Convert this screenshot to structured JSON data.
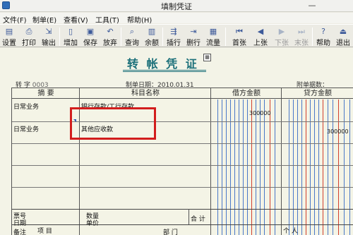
{
  "window": {
    "title": "填制凭证",
    "minimize_glyph": "—"
  },
  "menu": {
    "items": [
      "文件(F)",
      "制单(E)",
      "查看(V)",
      "工具(T)",
      "帮助(H)"
    ]
  },
  "toolbar": {
    "buttons": [
      {
        "label": "设置",
        "icon": "printer-setup-icon",
        "glyph": "▤",
        "enabled": true
      },
      {
        "label": "打印",
        "icon": "printer-icon",
        "glyph": "⎙",
        "enabled": true
      },
      {
        "label": "输出",
        "icon": "export-icon",
        "glyph": "⇲",
        "enabled": true
      },
      {
        "label": "增加",
        "icon": "add-document-icon",
        "glyph": "▯",
        "enabled": true
      },
      {
        "label": "保存",
        "icon": "save-icon",
        "glyph": "▣",
        "enabled": true
      },
      {
        "label": "放弃",
        "icon": "discard-icon",
        "glyph": "↶",
        "enabled": true
      },
      {
        "label": "查询",
        "icon": "binoculars-icon",
        "glyph": "⌕",
        "enabled": true
      },
      {
        "label": "余额",
        "icon": "balance-chart-icon",
        "glyph": "▥",
        "enabled": true
      },
      {
        "label": "插行",
        "icon": "insert-row-icon",
        "glyph": "⇶",
        "enabled": true
      },
      {
        "label": "删行",
        "icon": "delete-row-icon",
        "glyph": "⇥",
        "enabled": true
      },
      {
        "label": "流量",
        "icon": "cash-flow-icon",
        "glyph": "▦",
        "enabled": true
      },
      {
        "label": "首张",
        "icon": "first-page-icon",
        "glyph": "⏮",
        "enabled": true
      },
      {
        "label": "上张",
        "icon": "previous-page-icon",
        "glyph": "◀",
        "enabled": true
      },
      {
        "label": "下张",
        "icon": "next-page-icon",
        "glyph": "▶",
        "enabled": false
      },
      {
        "label": "末张",
        "icon": "last-page-icon",
        "glyph": "⏭",
        "enabled": false
      },
      {
        "label": "帮助",
        "icon": "help-icon",
        "glyph": "?",
        "enabled": true
      },
      {
        "label": "退出",
        "icon": "exit-icon",
        "glyph": "⏏",
        "enabled": true
      }
    ]
  },
  "voucher": {
    "title": "转 帐 凭 证",
    "calc_glyph": "▦",
    "word_label": "转  字",
    "number": "0003",
    "date_label": "制单日期：",
    "date": "2010.01.31",
    "attachments_label": "附单据数：",
    "headers": {
      "summary": "摘  要",
      "account": "科目名称",
      "debit": "借方金额",
      "credit": "贷方金额"
    },
    "rows": [
      {
        "summary": "日常业务",
        "account": "银行存款/工行存款",
        "debit": "300000",
        "credit": ""
      },
      {
        "summary": "日常业务",
        "account": "其他应收款",
        "debit": "",
        "credit": "300000"
      }
    ],
    "footer": {
      "ticket_no": "票号",
      "date": "日期",
      "quantity": "数量",
      "unit_price": "单价",
      "total": "合  计",
      "remark": "备注",
      "item": "项  目",
      "dept": "部  门",
      "person": "个  人"
    }
  }
}
